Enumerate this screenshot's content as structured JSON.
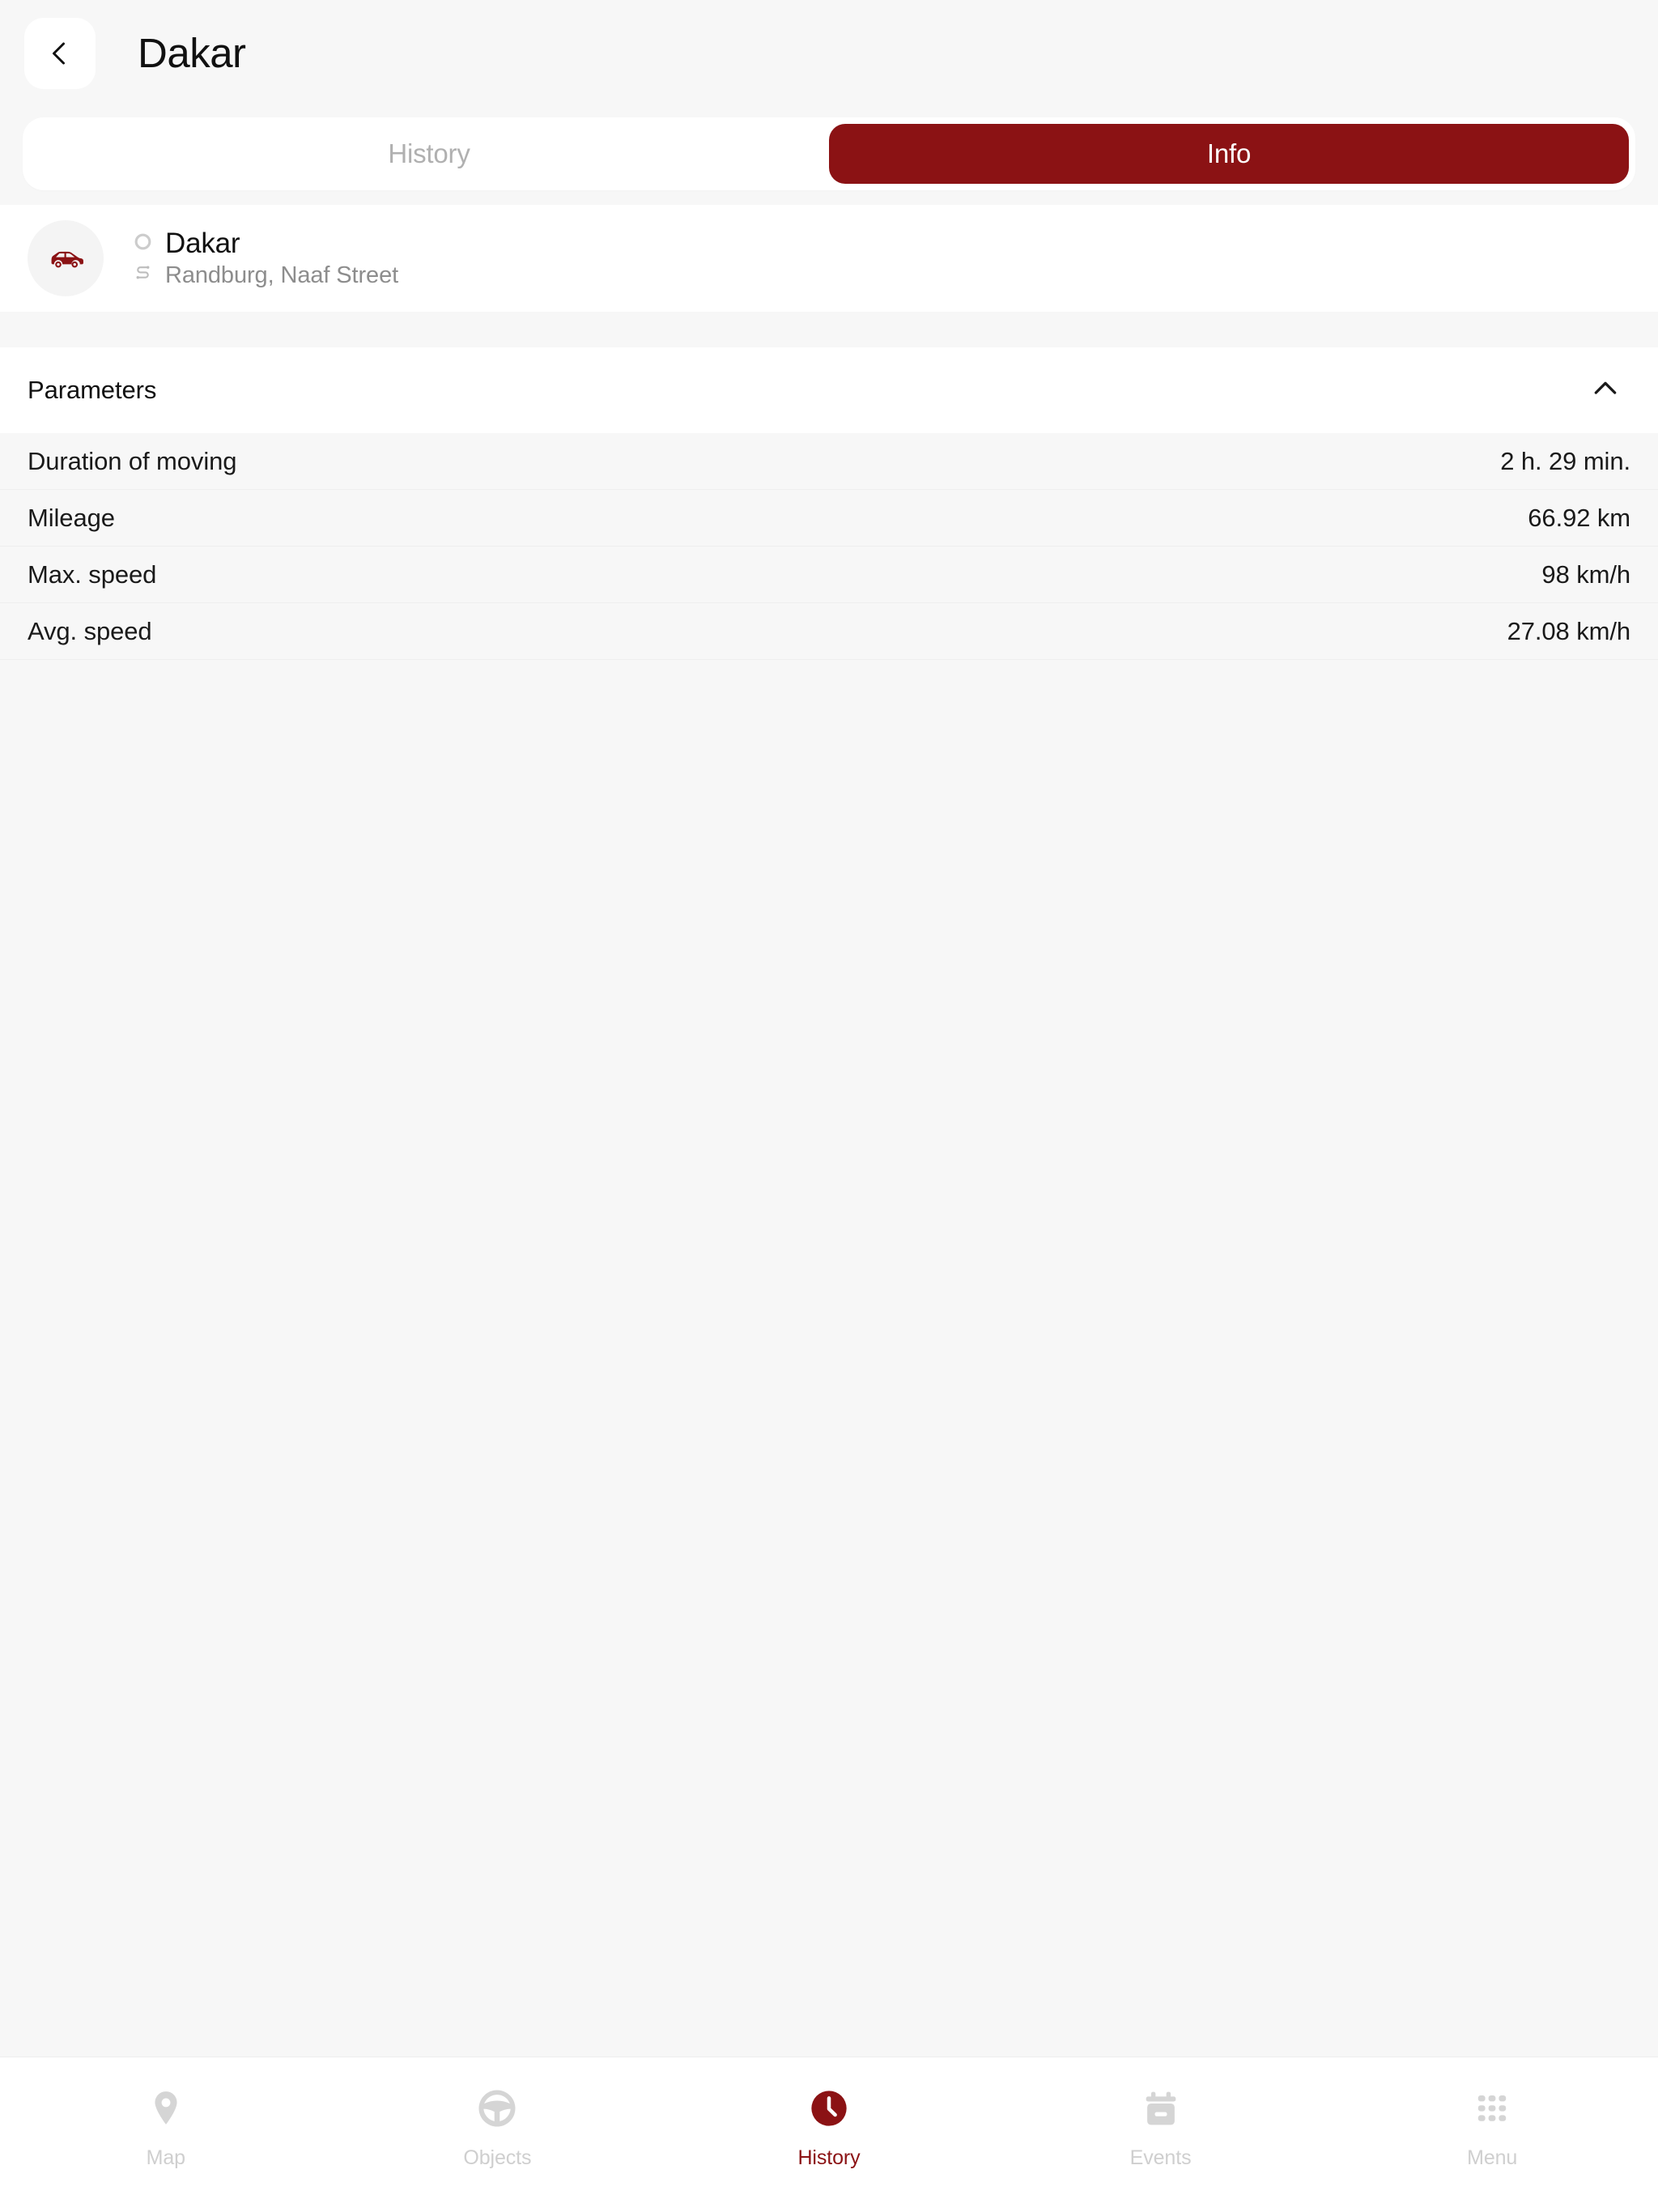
{
  "theme": {
    "accent": "#8b1214",
    "page_bg": "#f7f7f7",
    "card_bg": "#ffffff",
    "muted_text": "#b0b0b0",
    "nav_inactive": "#cfcfcf"
  },
  "header": {
    "back_icon": "chevron-left-icon",
    "title": "Dakar"
  },
  "tabs": [
    {
      "label": "History",
      "active": false
    },
    {
      "label": "Info",
      "active": true
    }
  ],
  "object": {
    "avatar_icon": "car-icon",
    "status_icon": "status-circle-icon",
    "name": "Dakar",
    "address_icon": "route-icon",
    "address": "Randburg, Naaf Street"
  },
  "parameters_section": {
    "title": "Parameters",
    "toggle_icon": "chevron-up-icon",
    "expanded": true,
    "rows": [
      {
        "label": "Duration of moving",
        "value": "2 h. 29 min."
      },
      {
        "label": "Mileage",
        "value": "66.92 km"
      },
      {
        "label": "Max. speed",
        "value": "98 km/h"
      },
      {
        "label": "Avg. speed",
        "value": "27.08 km/h"
      }
    ]
  },
  "bottom_nav": [
    {
      "label": "Map",
      "icon": "map-pin-icon",
      "active": false
    },
    {
      "label": "Objects",
      "icon": "steering-wheel-icon",
      "active": false
    },
    {
      "label": "History",
      "icon": "clock-icon",
      "active": true
    },
    {
      "label": "Events",
      "icon": "calendar-icon",
      "active": false
    },
    {
      "label": "Menu",
      "icon": "grid-dots-icon",
      "active": false
    }
  ]
}
